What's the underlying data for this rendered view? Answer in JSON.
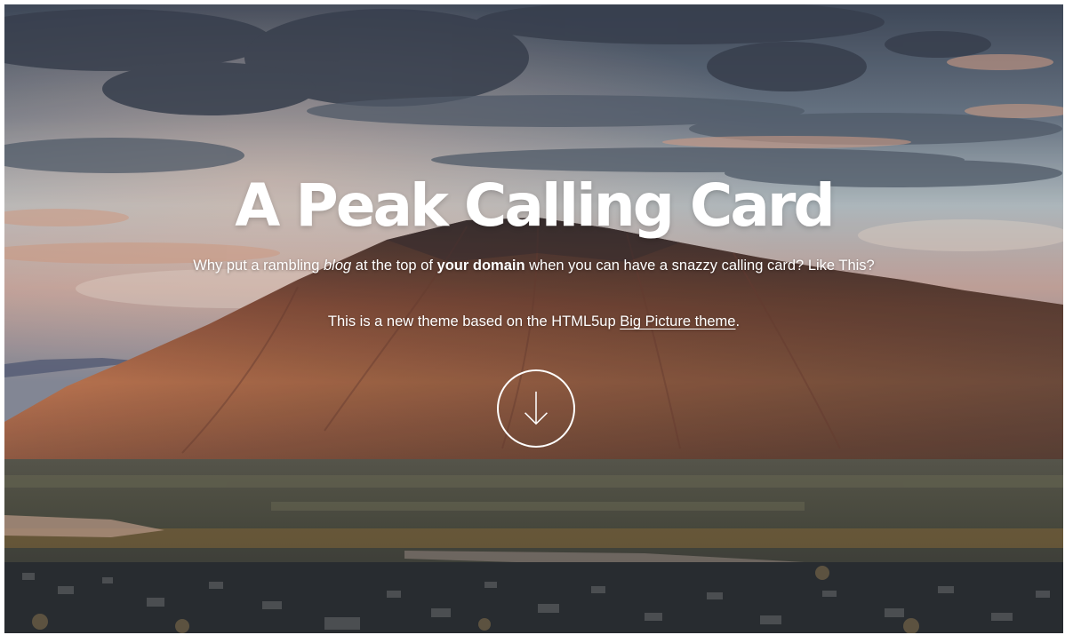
{
  "hero": {
    "title": "A Peak Calling Card",
    "tagline": {
      "part1": "Why put a rambling ",
      "em": "blog",
      "part2": " at the top of ",
      "strong": "your domain",
      "part3": " when you can have a snazzy calling card? Like This?"
    },
    "credit": {
      "prefix": "This is a new theme based on the HTML5up ",
      "link_text": "Big Picture theme",
      "suffix": "."
    },
    "scroll_icon": "arrow-down-icon",
    "background": "mountain-sunset-photo"
  },
  "colors": {
    "text": "#ffffff",
    "sky_top": "#3f4a5b",
    "sky_mid": "#a7b3bd",
    "mountain_lit": "#c47552",
    "mountain_shadow": "#3a3433",
    "valley": "#4a4d43",
    "town": "#2f3337"
  }
}
